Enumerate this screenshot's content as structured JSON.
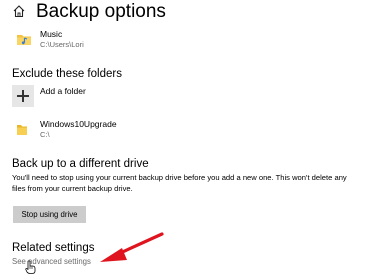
{
  "header": {
    "title": "Backup options",
    "icon": "home-icon"
  },
  "backup_folders": {
    "items": [
      {
        "name": "Music",
        "path": "C:\\Users\\Lori",
        "icon": "music-folder-icon"
      }
    ]
  },
  "exclude": {
    "heading": "Exclude these folders",
    "add_label": "Add a folder",
    "add_icon": "plus-icon",
    "items": [
      {
        "name": "Windows10Upgrade",
        "path": "C:\\",
        "icon": "folder-icon"
      }
    ]
  },
  "different_drive": {
    "heading": "Back up to a different drive",
    "description": "You'll need to stop using your current backup drive before you add a new one. This won't delete any files from your current backup drive.",
    "button_label": "Stop using drive"
  },
  "related": {
    "heading": "Related settings",
    "link_label": "See advanced settings"
  },
  "annotation": {
    "arrow_color": "#e0141e",
    "arrow_icon": "red-arrow-icon",
    "cursor_icon": "hand-cursor-icon"
  }
}
